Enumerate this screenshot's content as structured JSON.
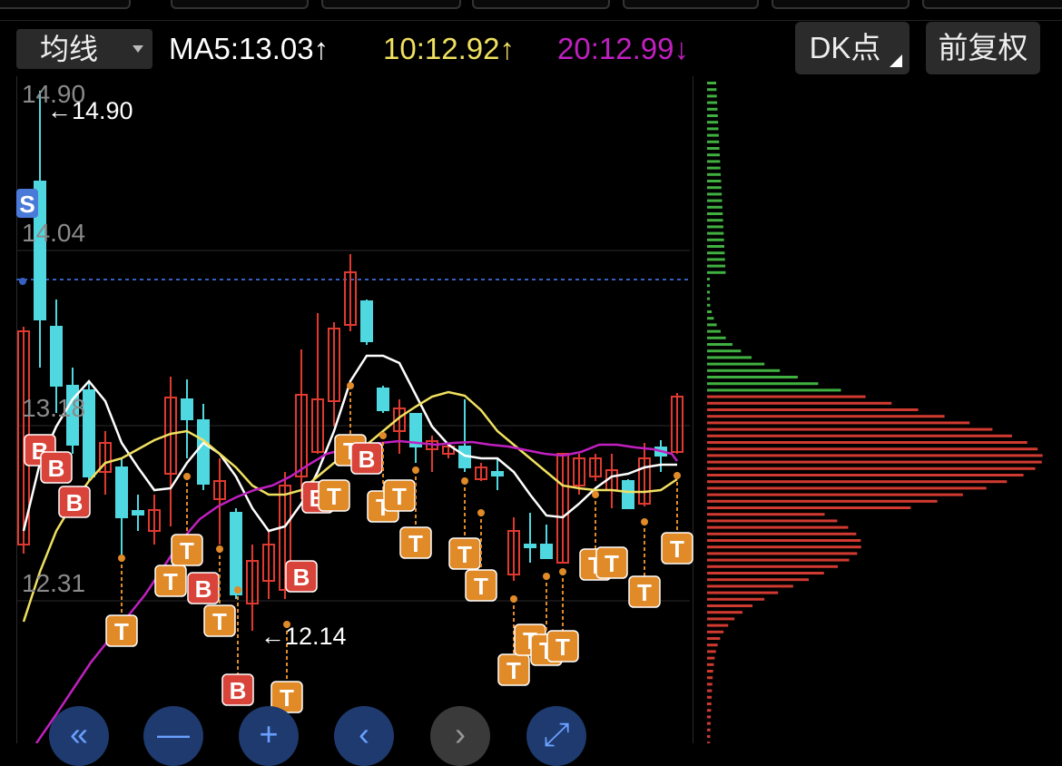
{
  "toolbar": {
    "ma_select": "均线",
    "ma5": "MA5:13.03↑",
    "ma10": "10:12.92↑",
    "ma20": "20:12.99↓",
    "dk_button": "DK点",
    "adjust_button": "前复权"
  },
  "price_axis": {
    "labels": [
      "14.90",
      "14.04",
      "13.18",
      "12.31"
    ]
  },
  "annotations": {
    "high_label": "←14.90",
    "low_label": "←12.14",
    "s_marker": "S"
  },
  "marker_letters": {
    "buy": "B",
    "sell": "T"
  },
  "nav": {
    "first": "«",
    "zoom_out": "—",
    "zoom_in": "+",
    "prev": "‹",
    "next": "›",
    "fullscreen": "⤢"
  },
  "colors": {
    "ma5": "#ffffff",
    "ma10": "#f0e060",
    "ma20": "#c020c0",
    "up": "#e03a30",
    "down": "#50d8e0",
    "marker_t": "#e08a28",
    "marker_b": "#d8443a",
    "profile_up": "#40b040",
    "profile_down": "#d03a30"
  }
}
